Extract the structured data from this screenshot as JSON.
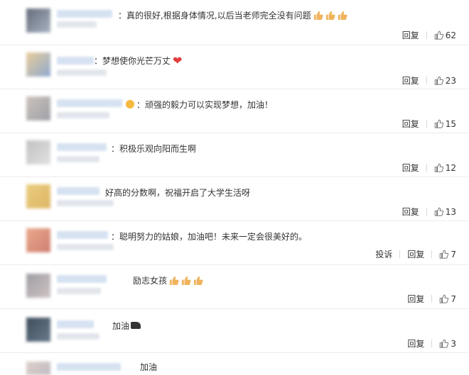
{
  "comments": [
    {
      "text": "：真的很好,根据身体情况,以后当老师完全没有问题",
      "emoji": "thumbs-up-icon x3",
      "reply": "回复",
      "likes": "62"
    },
    {
      "text": "：梦想使你光芒万丈",
      "emoji": "heart-icon",
      "reply": "回复",
      "likes": "23"
    },
    {
      "text": "：顽强的毅力可以实现梦想，加油！",
      "emoji": "smile-emoji-icon",
      "reply": "回复",
      "likes": "15"
    },
    {
      "text": "：积极乐观向阳而生啊",
      "reply": "回复",
      "likes": "12"
    },
    {
      "text": "好高的分数啊，祝福开启了大学生活呀",
      "reply": "回复",
      "likes": "13"
    },
    {
      "text": "：聪明努力的姑娘，加油吧！未来一定会很美好的。",
      "report": "投诉",
      "reply": "回复",
      "likes": "7"
    },
    {
      "text": "励志女孩",
      "emoji": "thumbs-up-icon x3",
      "reply": "回复",
      "likes": "7"
    },
    {
      "text": "加油",
      "emoji": "flex-arm-icon",
      "reply": "回复",
      "likes": "3"
    },
    {
      "text": "加油"
    }
  ],
  "colors": {
    "text": "#333333",
    "heart": "#e23c3c",
    "thumb": "#f0b35c",
    "divider": "#ececec"
  }
}
